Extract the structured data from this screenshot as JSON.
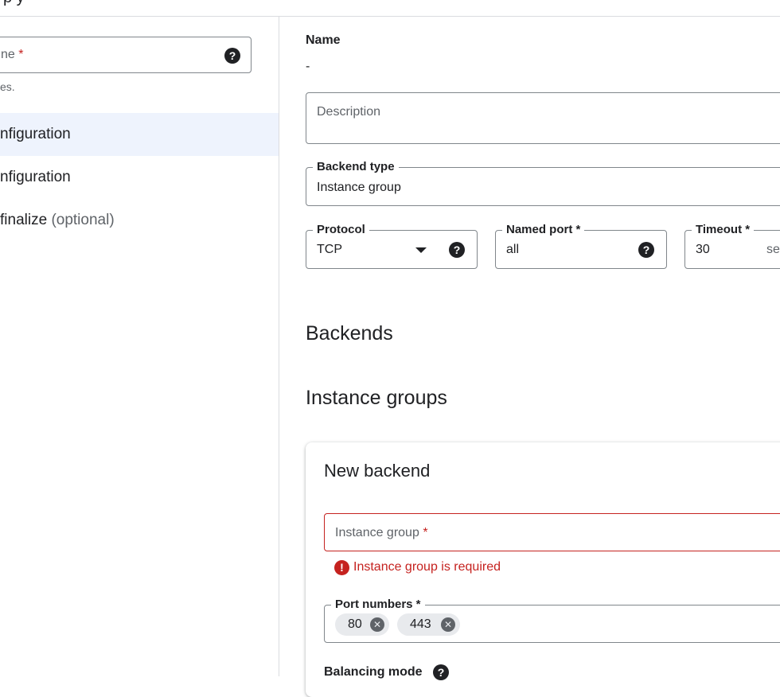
{
  "header": {
    "title_fragment": "p y"
  },
  "left": {
    "name_field": {
      "label": "ne",
      "required": "*",
      "help_icon": "?"
    },
    "hint": "es.",
    "steps": [
      {
        "label": "nfiguration",
        "optional": ""
      },
      {
        "label": "nfiguration",
        "optional": ""
      },
      {
        "label": "finalize",
        "optional": "(optional)"
      }
    ]
  },
  "right": {
    "name_label": "Name",
    "name_value": "-",
    "description_placeholder": "Description",
    "backend_type": {
      "label": "Backend type",
      "value": "Instance group"
    },
    "protocol": {
      "label": "Protocol",
      "value": "TCP",
      "help_icon": "?"
    },
    "named_port": {
      "label": "Named port *",
      "value": "all",
      "help_icon": "?"
    },
    "timeout": {
      "label": "Timeout *",
      "value": "30",
      "unit": "se"
    },
    "backends_heading": "Backends",
    "instance_groups_heading": "Instance groups",
    "new_backend": {
      "title": "New backend",
      "instance_group_placeholder": "Instance group",
      "required": "*",
      "error_icon": "!",
      "error_text": "Instance group is required",
      "port_numbers_label": "Port numbers *",
      "ports": [
        "80",
        "443"
      ],
      "chip_remove_icon": "✕",
      "balancing_mode_label": "Balancing mode",
      "help_icon": "?"
    }
  },
  "colors": {
    "accent_bg": "#eef3fd",
    "error": "#c5221f",
    "border": "#80868b",
    "divider": "#dadce0"
  }
}
